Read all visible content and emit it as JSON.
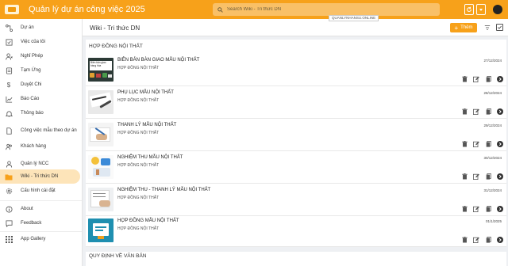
{
  "app": {
    "title": "Quản lý dự án công việc 2025",
    "user_chip": "QUANLYNHANSU.ONLINE"
  },
  "search": {
    "placeholder": "Search Wiki - Tri thức DN"
  },
  "sidebar": {
    "items": [
      {
        "label": "Dự án",
        "icon": "project-icon"
      },
      {
        "label": "Việc của tôi",
        "icon": "task-icon"
      },
      {
        "label": "Nghỉ Phép",
        "icon": "person-leave-icon"
      },
      {
        "label": "Tạm Ứng",
        "icon": "advance-payment-icon"
      },
      {
        "label": "Duyệt Chi",
        "icon": "dollar-icon"
      },
      {
        "label": "Báo Cáo",
        "icon": "chart-icon"
      },
      {
        "label": "Thông báo",
        "icon": "bell-icon"
      },
      {
        "label": "Công việc mẫu theo dự án",
        "icon": "document-icon"
      },
      {
        "label": "Khách hàng",
        "icon": "customers-icon"
      },
      {
        "label": "Quản lý NCC",
        "icon": "supplier-icon"
      },
      {
        "label": "Wiki - Tri thức DN",
        "icon": "wiki-icon",
        "active": true
      },
      {
        "label": "Cấu hình cài đặt",
        "icon": "settings-icon"
      },
      {
        "label": "About",
        "icon": "info-icon"
      },
      {
        "label": "Feedback",
        "icon": "feedback-icon"
      },
      {
        "label": "App Gallery",
        "icon": "grid-icon"
      }
    ]
  },
  "header": {
    "title": "Wiki - Tri thức DN",
    "add_label": "Thêm"
  },
  "section": {
    "title": "HỢP ĐỒNG NỘI THẤT",
    "next_title": "QUY ĐỊNH VỀ VĂN BẢN"
  },
  "documents": [
    {
      "title": "BIÊN BẢN BÀN GIAO MẪU NỘI THẤT",
      "category": "HỢP ĐỒNG NỘI THẤT",
      "date": "27/12/2024",
      "thumb_text": "Biên bản giao hàng hóa"
    },
    {
      "title": "PHỤ LỤC MẪU NỘI THẤT",
      "category": "HỢP ĐỒNG NỘI THẤT",
      "date": "28/12/2024"
    },
    {
      "title": "THANH LÝ MẪU NỘI THẤT",
      "category": "HỢP ĐỒNG NỘI THẤT",
      "date": "29/12/2024"
    },
    {
      "title": "NGHIỆM THU MẪU NỘI THẤT",
      "category": "HỢP ĐỒNG NỘI THẤT",
      "date": "30/12/2024"
    },
    {
      "title": "NGHIỆM THU - THANH LÝ MẪU NỘI THẤT",
      "category": "HỢP ĐỒNG NỘI THẤT",
      "date": "31/12/2024"
    },
    {
      "title": "HỢP ĐỒNG MẪU NỘI THẤT",
      "category": "HỢP ĐỒNG NỘI THẤT",
      "date": "01/1/2025"
    }
  ],
  "colors": {
    "accent": "#f7a11a",
    "active_bg": "#fde4b9"
  }
}
